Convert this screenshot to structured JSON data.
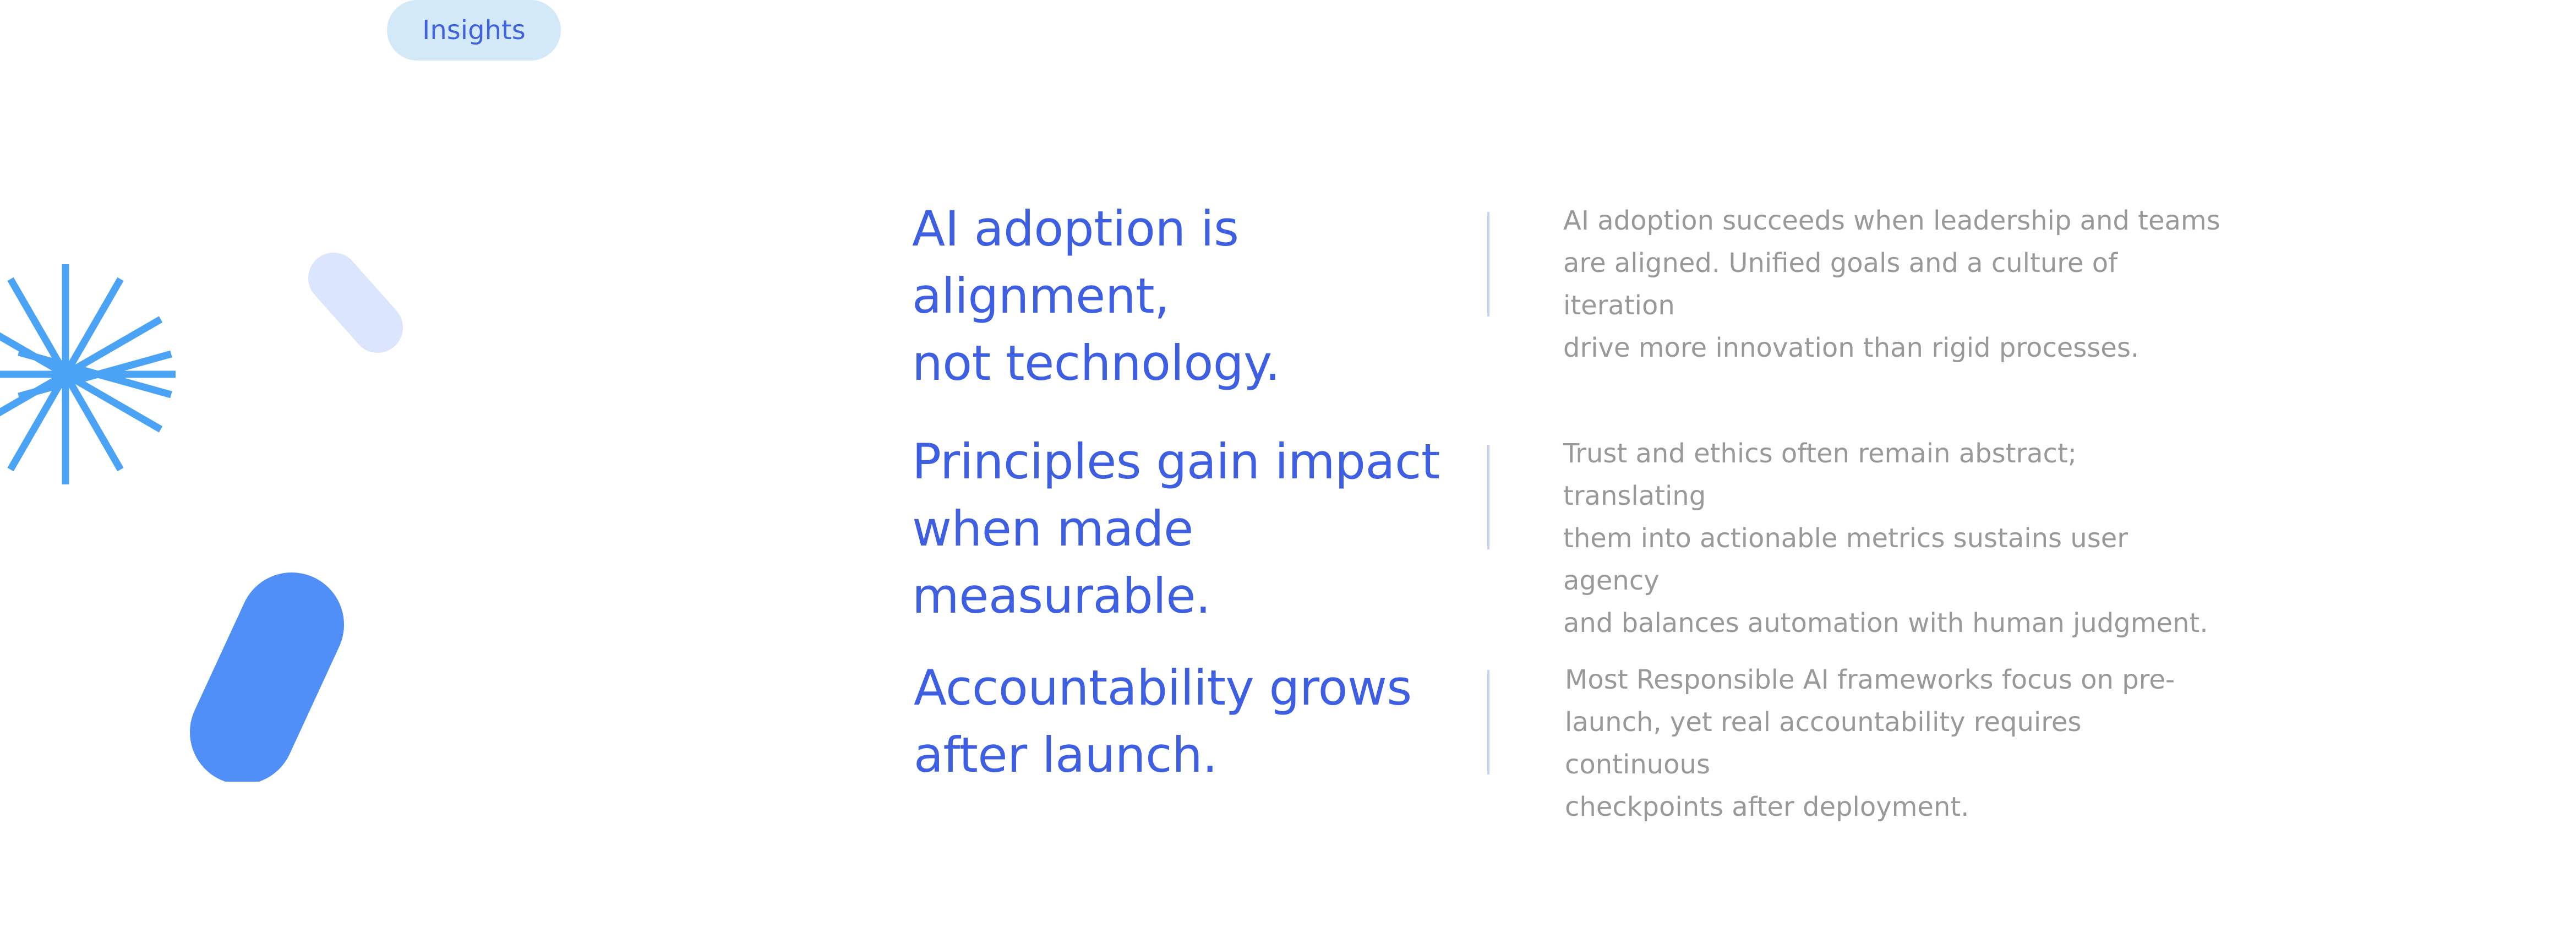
{
  "tag": {
    "label": "Insights"
  },
  "insights": [
    {
      "heading_line1": "AI adoption is alignment,",
      "heading_line2": "not technology.",
      "body_line1": "AI adoption succeeds when leadership and teams",
      "body_line2": "are aligned. Unified goals and a culture of iteration",
      "body_line3": "drive more innovation than rigid processes."
    },
    {
      "heading_line1": "Principles gain impact",
      "heading_line2": "when made measurable.",
      "body_line1": "Trust and ethics often remain abstract; translating",
      "body_line2": "them into actionable metrics sustains user agency",
      "body_line3": "and balances automation with human judgment."
    },
    {
      "heading_line1": "Accountability grows",
      "heading_line2": "after launch.",
      "body_line1": "Most Responsible AI frameworks focus on pre-",
      "body_line2": "launch, yet real accountability requires continuous",
      "body_line3": "checkpoints after deployment."
    }
  ],
  "decorations": {
    "starburst_icon": "starburst-icon",
    "capsule_icon": "capsule-shape",
    "blob_icon": "textured-capsule-shape",
    "colors": {
      "heading": "#3f5fe3",
      "body": "#999999",
      "pill_bg": "#d3e9f7",
      "starburst": "#4aa3f5",
      "soft_capsule": "#dbe5fd",
      "blob": "#4f8ff7"
    }
  }
}
